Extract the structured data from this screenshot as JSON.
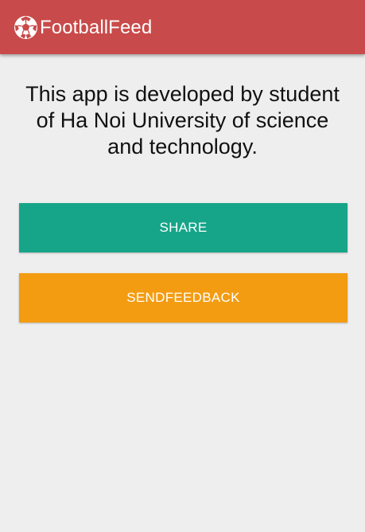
{
  "app": {
    "title": "FootballFeed",
    "logo_icon": "soccer-ball-icon"
  },
  "colors": {
    "appbar": "#c94a4a",
    "background": "#eeeeee",
    "share_button": "#17a589",
    "feedback_button": "#f39c12"
  },
  "about": {
    "message": "This app is developed by student of Ha Noi University of science and technology."
  },
  "buttons": {
    "share_label": "SHARE",
    "feedback_label": "SENDFEEDBACK"
  }
}
